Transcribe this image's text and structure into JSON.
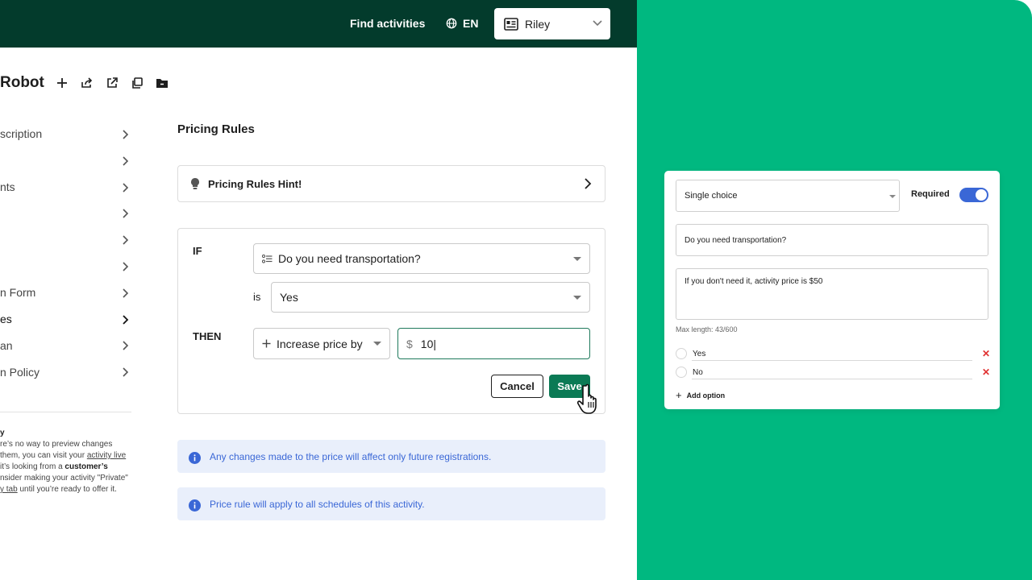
{
  "header": {
    "find_activities": "Find activities",
    "language": "EN",
    "user_name": "Riley"
  },
  "page": {
    "title": "Robot"
  },
  "sidebar": {
    "items": [
      {
        "label": "scription"
      },
      {
        "label": ""
      },
      {
        "label": "nts"
      },
      {
        "label": ""
      },
      {
        "label": ""
      },
      {
        "label": ""
      },
      {
        "label": "n Form"
      },
      {
        "label": "es"
      },
      {
        "label": "an"
      },
      {
        "label": "n Policy"
      }
    ],
    "note": {
      "heading": "y",
      "line1": "re’s no way to preview changes",
      "line2_a": "them, you can visit your ",
      "line2_link": "activity live",
      "line3_a": " it’s looking from a ",
      "line3_bold": "customer’s",
      "line4": "nsider making your activity \"Private\"",
      "line5_link": "y tab",
      "line5_b": " until you’re ready to offer it."
    }
  },
  "pricing": {
    "section_title": "Pricing Rules",
    "hint_label": "Pricing Rules Hint!",
    "if_label": "IF",
    "then_label": "THEN",
    "is_label": "is",
    "question_value": "Do you need transportation?",
    "answer_value": "Yes",
    "action_value": "Increase price by",
    "currency_symbol": "$",
    "amount_value": "10|",
    "cancel_label": "Cancel",
    "save_label": "Save",
    "info1": "Any changes made to the price will affect only future registrations.",
    "info2": "Price rule will apply to all schedules of this activity."
  },
  "question_card": {
    "type_value": "Single choice",
    "required_label": "Required",
    "required_on": true,
    "question_text": "Do you need transportation?",
    "description_text": "If you don't need it, activity price is $50",
    "max_length": "Max length: 43/600",
    "options": [
      {
        "label": "Yes"
      },
      {
        "label": "No"
      }
    ],
    "add_option_label": "Add option"
  },
  "colors": {
    "header_bg": "#033b2c",
    "panel_green": "#00b880",
    "save_button": "#0b7a55",
    "info_bg": "#e9effb",
    "info_text": "#3a67d6",
    "toggle_on": "#3a67d6",
    "remove_x": "#e03131"
  }
}
